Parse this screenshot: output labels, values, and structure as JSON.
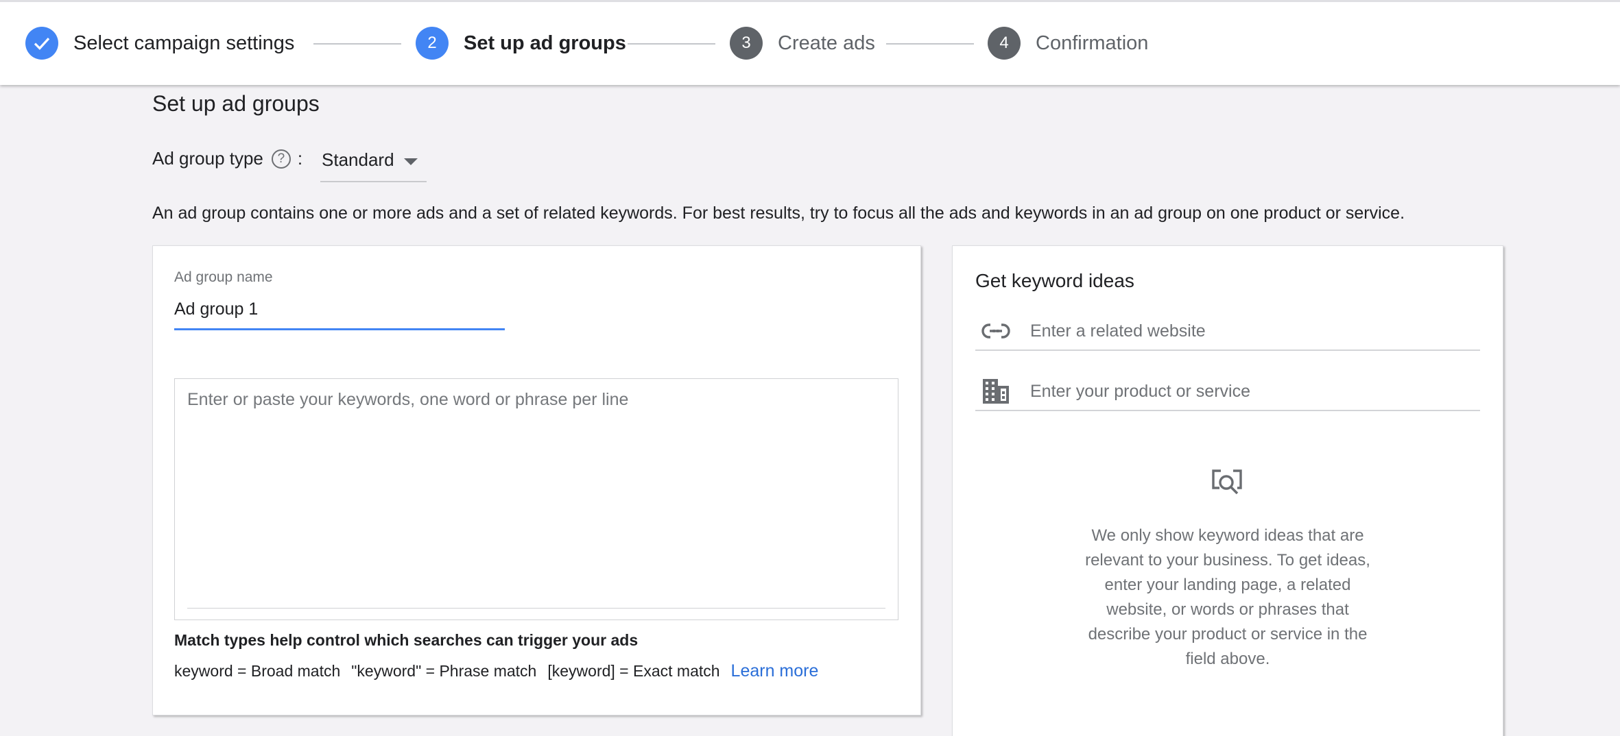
{
  "stepper": {
    "steps": [
      {
        "number": "",
        "label": "Select campaign settings",
        "state": "done"
      },
      {
        "number": "2",
        "label": "Set up ad groups",
        "state": "active"
      },
      {
        "number": "3",
        "label": "Create ads",
        "state": "pending"
      },
      {
        "number": "4",
        "label": "Confirmation",
        "state": "pending"
      }
    ]
  },
  "page": {
    "title": "Set up ad groups",
    "ad_group_type_label": "Ad group type",
    "ad_group_type_colon": ":",
    "ad_group_type_value": "Standard",
    "description": "An ad group contains one or more ads and a set of related keywords. For best results, try to focus all the ads and keywords in an ad group on one product or service."
  },
  "ad_group": {
    "name_label": "Ad group name",
    "name_value": "Ad group 1",
    "keywords_placeholder": "Enter or paste your keywords, one word or phrase per line",
    "match_title": "Match types help control which searches can trigger your ads",
    "broad": "keyword = Broad match",
    "phrase": "\"keyword\" = Phrase match",
    "exact": "[keyword] = Exact match",
    "learn_more": "Learn more"
  },
  "keyword_ideas": {
    "title": "Get keyword ideas",
    "website_placeholder": "Enter a related website",
    "product_placeholder": "Enter your product or service",
    "empty_text": "We only show keyword ideas that are relevant to your business. To get ideas, enter your landing page, a related website, or words or phrases that describe your product or service in the field above."
  },
  "colors": {
    "accent": "#4285f4",
    "link": "#2a6ed8",
    "pending_step": "#5f6368"
  }
}
